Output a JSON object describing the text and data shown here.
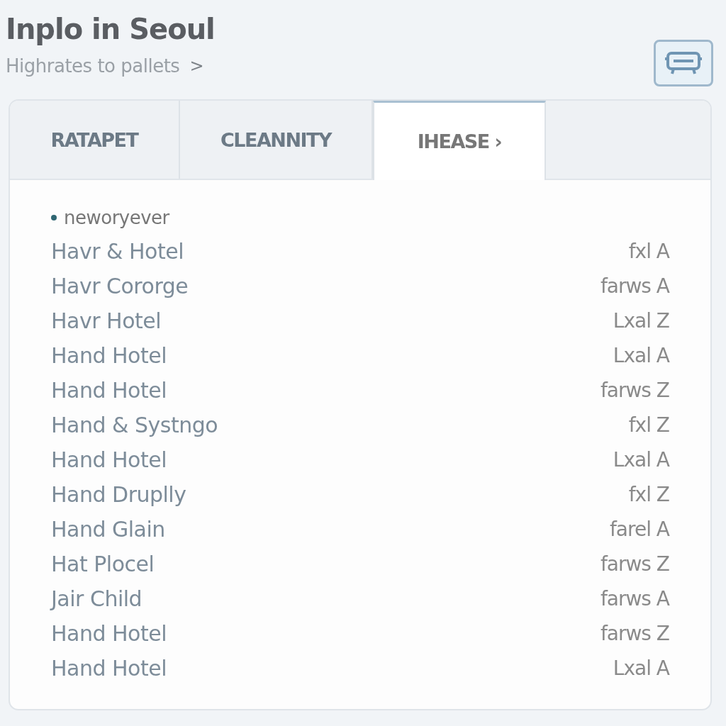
{
  "header": {
    "title": "Inplo in Seoul",
    "subtitle": "Highrates to pallets",
    "subtitle_arrow": ">"
  },
  "tabs": [
    {
      "label": "RATAPET",
      "selected": false
    },
    {
      "label": "CLEANNITY",
      "selected": false
    },
    {
      "label": "IHEASE ›",
      "selected": true
    }
  ],
  "list": {
    "heading": "neworyever",
    "rows": [
      {
        "name": "Havr & Hotel",
        "value": "fxl A"
      },
      {
        "name": "Havr Cororge",
        "value": "farws A"
      },
      {
        "name": "Havr Hotel",
        "value": "Lxal Z"
      },
      {
        "name": "Hand Hotel",
        "value": "Lxal A"
      },
      {
        "name": "Hand Hotel",
        "value": "farws Z"
      },
      {
        "name": "Hand & Systngo",
        "value": "fxl Z"
      },
      {
        "name": "Hand Hotel",
        "value": "Lxal A"
      },
      {
        "name": "Hand Druplly",
        "value": "fxl Z"
      },
      {
        "name": "Hand Glain",
        "value": "farel A"
      },
      {
        "name": "Hat Plocel",
        "value": "farws Z"
      },
      {
        "name": "Jair Child",
        "value": "farws A"
      },
      {
        "name": "Hand Hotel",
        "value": "farws Z"
      },
      {
        "name": "Hand Hotel",
        "value": "Lxal A"
      }
    ]
  }
}
